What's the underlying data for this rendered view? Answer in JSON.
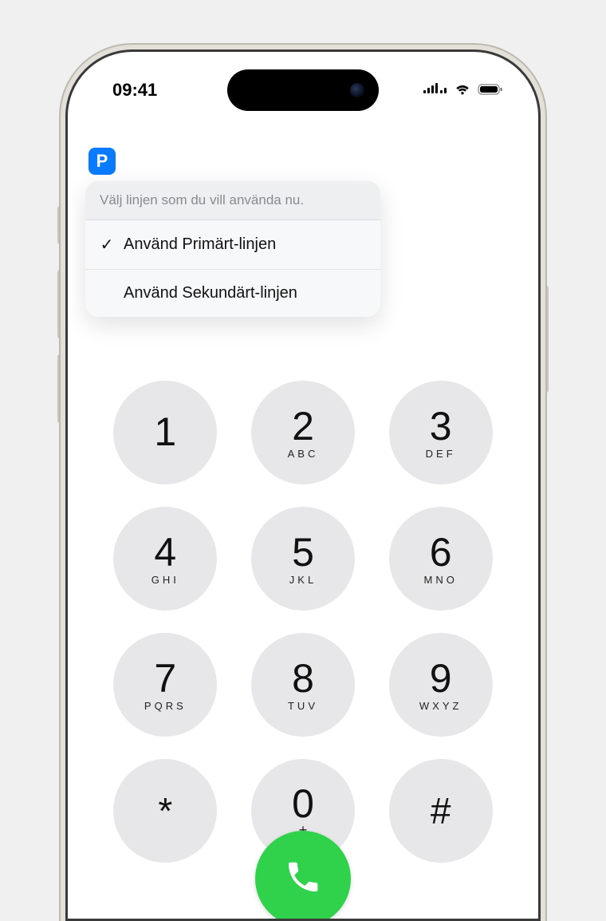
{
  "status": {
    "time": "09:41"
  },
  "line_badge": "P",
  "popover": {
    "header": "Välj linjen som du vill använda nu.",
    "primary": "Använd Primärt-linjen",
    "secondary": "Använd Sekundärt-linjen",
    "checkmark": "✓"
  },
  "keypad": {
    "k1": {
      "digit": "1",
      "letters": ""
    },
    "k2": {
      "digit": "2",
      "letters": "ABC"
    },
    "k3": {
      "digit": "3",
      "letters": "DEF"
    },
    "k4": {
      "digit": "4",
      "letters": "GHI"
    },
    "k5": {
      "digit": "5",
      "letters": "JKL"
    },
    "k6": {
      "digit": "6",
      "letters": "MNO"
    },
    "k7": {
      "digit": "7",
      "letters": "PQRS"
    },
    "k8": {
      "digit": "8",
      "letters": "TUV"
    },
    "k9": {
      "digit": "9",
      "letters": "WXYZ"
    },
    "star": "*",
    "zero": {
      "digit": "0",
      "plus": "+"
    },
    "pound": "#"
  }
}
